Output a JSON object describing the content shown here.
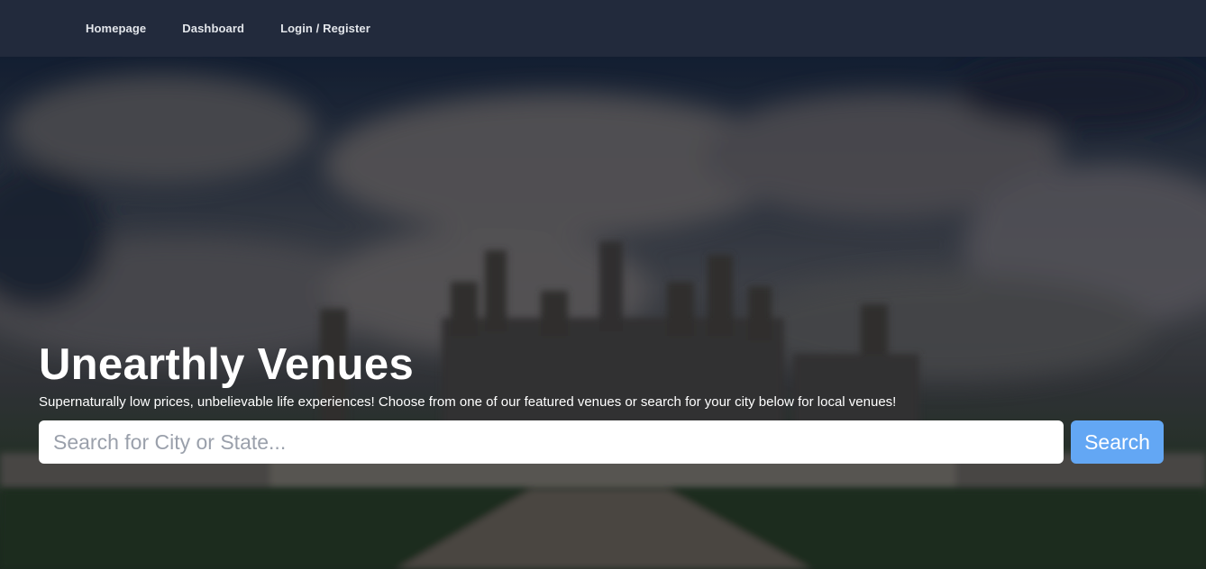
{
  "nav": {
    "items": [
      {
        "label": "Homepage"
      },
      {
        "label": "Dashboard"
      },
      {
        "label": "Login / Register"
      }
    ]
  },
  "hero": {
    "title": "Unearthly Venues",
    "subtitle": "Supernaturally low prices, unbelievable life experiences! Choose from one of our featured venues or search for your city below for local venues!",
    "background_image": "blurred-chateau-castle-photo"
  },
  "search": {
    "placeholder": "Search for City or State...",
    "value": "",
    "button_label": "Search"
  },
  "colors": {
    "navbar_bg": "#222a3c",
    "button_bg": "#63a7f4",
    "text": "#ffffff"
  }
}
